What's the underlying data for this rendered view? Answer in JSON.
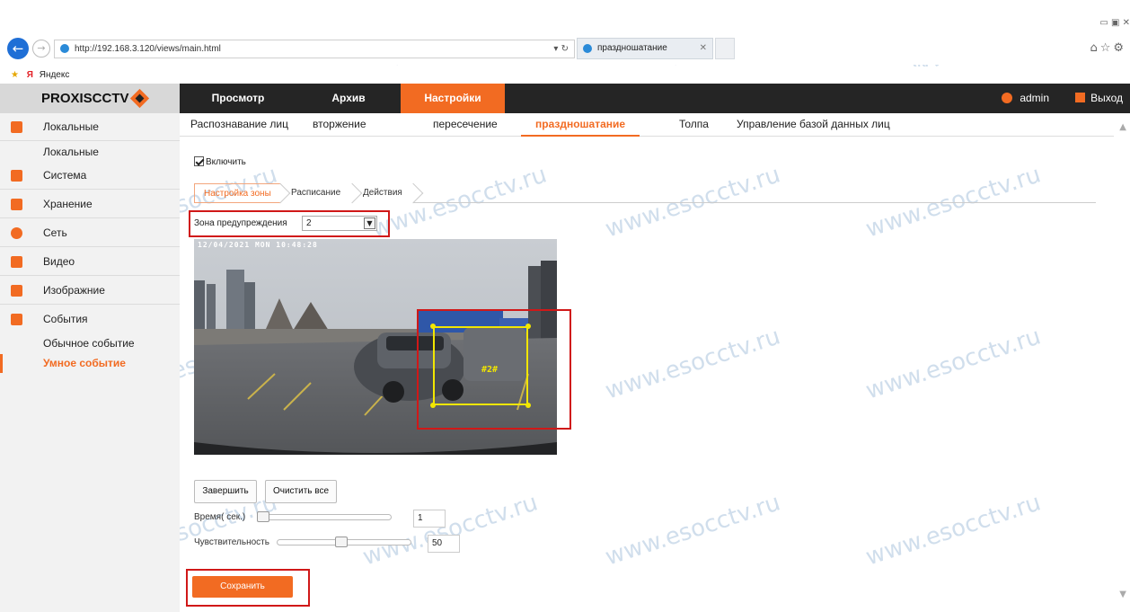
{
  "browser": {
    "url": "http://192.168.3.120/views/main.html",
    "tab_title": "празднoшатание",
    "favorites_item": "Яндекс"
  },
  "app": {
    "logo": "PROXISCCTV",
    "nav": [
      "Просмотр",
      "Архив",
      "Настройки"
    ],
    "active_nav": "Настройки",
    "user": "admin",
    "logout": "Выход"
  },
  "sidebar": {
    "items": [
      {
        "label": "Локальные",
        "icon": "monitor-icon"
      },
      {
        "sub": "Локальные"
      },
      {
        "label": "Система",
        "icon": "system-icon"
      },
      {
        "label": "Хранение",
        "icon": "storage-icon"
      },
      {
        "label": "Сеть",
        "icon": "network-icon"
      },
      {
        "label": "Видео",
        "icon": "video-icon"
      },
      {
        "label": "Изображние",
        "icon": "image-icon"
      },
      {
        "label": "События",
        "icon": "events-icon"
      },
      {
        "sub": "Обычное событие"
      },
      {
        "sub": "Умное событие",
        "active": true
      }
    ]
  },
  "subtabs": [
    "Распознавание лиц",
    "вторжение",
    "пересечение",
    "празднoшатание",
    "Толпа",
    "Управление базой данных лиц"
  ],
  "active_subtab": "празднoшатание",
  "form": {
    "enable_label": "Включить",
    "enable_checked": true,
    "steps": [
      "Настройка зоны",
      "Расписание",
      "Действия"
    ],
    "zone_label": "Зона предупреждения",
    "zone_value": "2",
    "osd_text": "12/04/2021 MON 10:48:28",
    "zone_overlay_label": "#2#",
    "finish_button": "Завершить",
    "clear_button": "Очистить все",
    "time_label": "Время( сек.)",
    "time_value": "1",
    "sensitivity_label": "Чувствительность",
    "sensitivity_value": "50",
    "save_button": "Сохранить"
  },
  "watermark": "www.esocctv.ru",
  "colors": {
    "accent": "#f26b22",
    "header": "#252525",
    "highlight": "#d01818",
    "zone": "#f2e600"
  }
}
